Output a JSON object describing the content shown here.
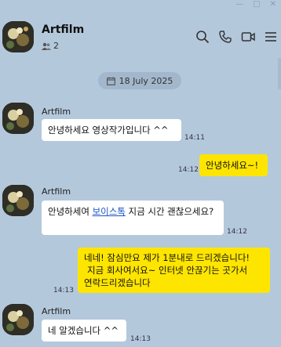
{
  "window": {
    "minimize_icon": "minimize-icon",
    "maximize_icon": "maximize-icon",
    "close_icon": "close-icon"
  },
  "header": {
    "title": "Artfilm",
    "member_count": "2",
    "icons": [
      "search-icon",
      "phone-icon",
      "video-icon",
      "menu-icon"
    ]
  },
  "date_divider": "18 July 2025",
  "messages": [
    {
      "sender": "Artfilm",
      "text": "안녕하세요 영상작가입니다 ^^",
      "time": "14:11",
      "mine": false
    },
    {
      "text": "안녕하세요~!",
      "time": "14:12",
      "mine": true
    },
    {
      "sender": "Artfilm",
      "text_before": "안녕하세여 ",
      "link": "보이스톡",
      "text_after": " 지금 시간 괜찮으세요?",
      "time": "14:12",
      "mine": false
    },
    {
      "text_line1": "네네! 잠심만요 제가 1분내로 드리겠습니다!",
      "text_line2": "지금 회사여서요~ 인터넷 안끊기는 곳가서",
      "text_line3": "연락드리겠습니다",
      "time": "14:13",
      "mine": true
    },
    {
      "sender": "Artfilm",
      "text": "네 알겠습니다 ^^",
      "time": "14:13",
      "mine": false
    }
  ],
  "colors": {
    "background": "#b4c8dc",
    "my_bubble": "#fee500",
    "their_bubble": "#ffffff",
    "link": "#1a54c8"
  }
}
